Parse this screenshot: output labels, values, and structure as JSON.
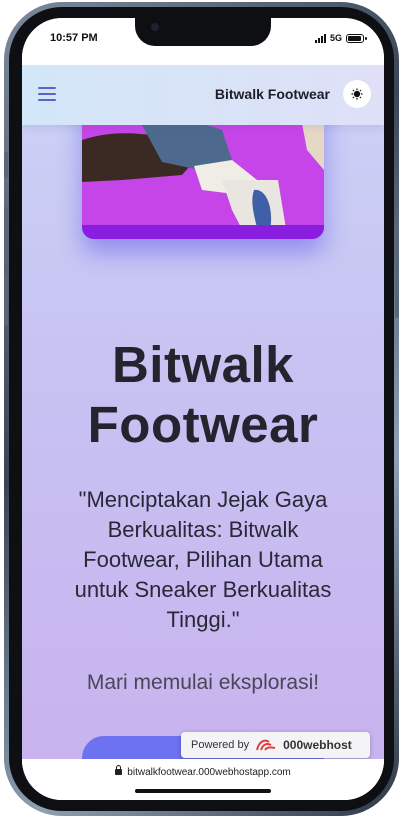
{
  "status_bar": {
    "time": "10:57 PM",
    "network": "5G"
  },
  "navbar": {
    "menu_icon": "hamburger-menu-icon",
    "brand": "Bitwalk Footwear",
    "toggle_icon": "theme-toggle-icon"
  },
  "hero": {
    "image": "sneaker-photo",
    "title_line1": "Bitwalk",
    "title_line2": "Footwear",
    "quote": "\"Menciptakan Jejak Gaya Berkualitas: Bitwalk Footwear, Pilihan Utama untuk Sneaker Berkualitas Tinggi.\"",
    "explore": "Mari memulai eksplorasi!"
  },
  "badge": {
    "powered_by": "Powered by",
    "host": "000webhost"
  },
  "browser": {
    "url": "bitwalkfootwear.000webhostapp.com"
  },
  "colors": {
    "accent": "#5a64c8",
    "hero_bg": "#c645e8",
    "cta": "#6c72f0"
  }
}
